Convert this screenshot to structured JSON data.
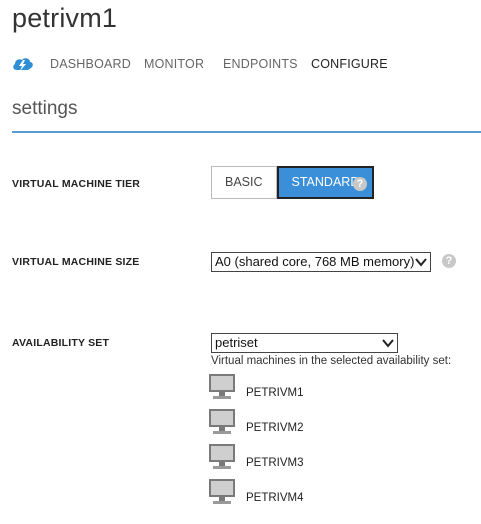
{
  "page": {
    "title": "petrivm1"
  },
  "nav": {
    "items": [
      {
        "label": "DASHBOARD"
      },
      {
        "label": "MONITOR"
      },
      {
        "label": "ENDPOINTS"
      },
      {
        "label": "CONFIGURE",
        "active": true
      }
    ]
  },
  "settings": {
    "title": "settings",
    "tier": {
      "label": "VIRTUAL MACHINE TIER",
      "options": [
        "BASIC",
        "STANDARD"
      ],
      "selected": "STANDARD",
      "help": "?"
    },
    "size": {
      "label": "VIRTUAL MACHINE SIZE",
      "value": "A0 (shared core, 768 MB memory)",
      "help": "?"
    },
    "availability": {
      "label": "AVAILABILITY SET",
      "value": "petriset",
      "note": "Virtual machines in the selected availability set:",
      "machines": [
        "PETRIVM1",
        "PETRIVM2",
        "PETRIVM3",
        "PETRIVM4"
      ]
    }
  },
  "colors": {
    "accent": "#3a8fd8",
    "rule": "#5b9bd5"
  }
}
